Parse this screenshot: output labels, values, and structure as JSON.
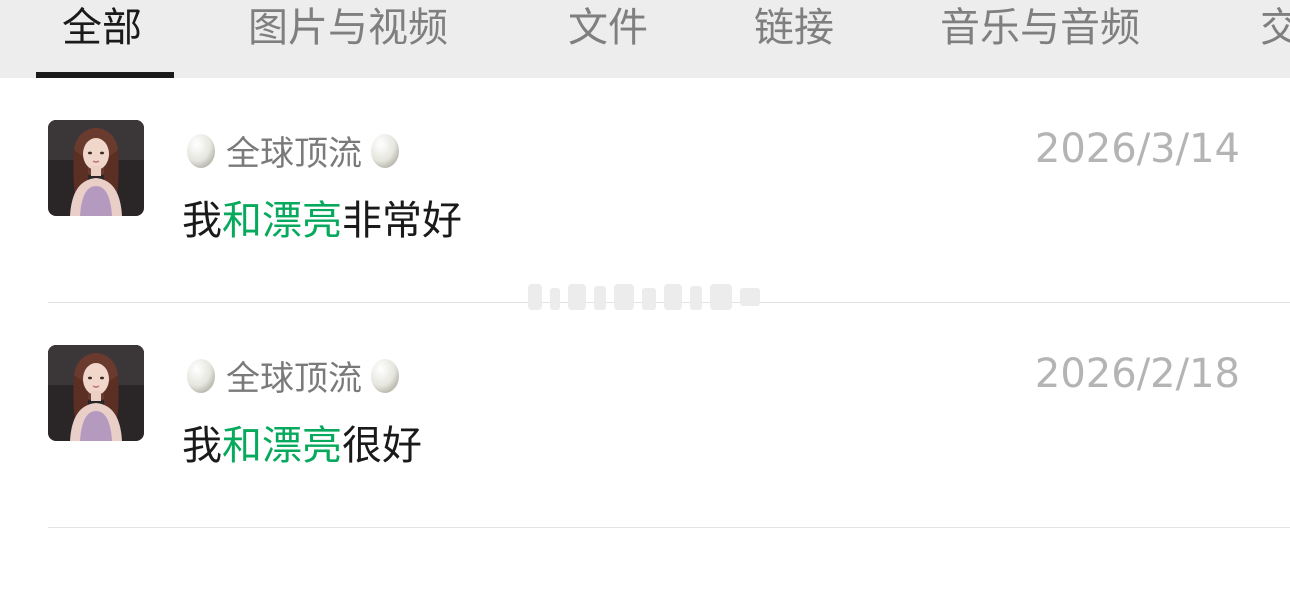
{
  "tabs": [
    {
      "label": "全部",
      "active": true
    },
    {
      "label": "图片与视频",
      "active": false
    },
    {
      "label": "文件",
      "active": false
    },
    {
      "label": "链接",
      "active": false
    },
    {
      "label": "音乐与音频",
      "active": false
    },
    {
      "label": "交",
      "active": false
    }
  ],
  "results": [
    {
      "sender": "全球顶流",
      "date": "2026/3/14",
      "message": {
        "before": "我",
        "highlight": "和漂亮",
        "after": "非常好"
      }
    },
    {
      "sender": "全球顶流",
      "date": "2026/2/18",
      "message": {
        "before": "我",
        "highlight": "和漂亮",
        "after": "很好"
      }
    }
  ],
  "colors": {
    "highlight": "#07a95c",
    "tab_active": "#1a1a1a",
    "tab_inactive": "#7f7f7f",
    "date": "#b4b4b4",
    "tabbar_bg": "#ededed"
  }
}
